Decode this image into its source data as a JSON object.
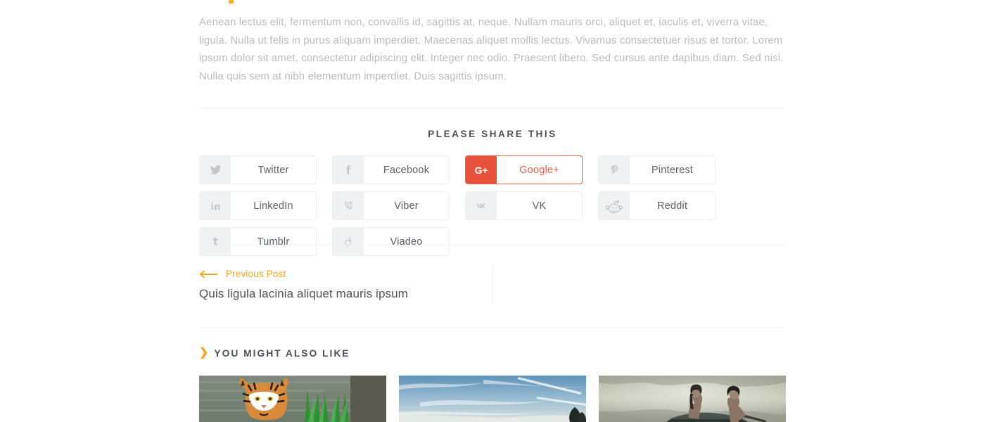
{
  "post": {
    "body": "Aenean lectus elit, fermentum non, convallis id, sagittis at, neque. Nullam mauris orci, aliquet et, iaculis et, viverra vitae, ligula. Nulla ut felis in purus aliquam imperdiet. Maecenas aliquet mollis lectus. Vivamus consectetuer risus et tortor. Lorem ipsum dolor sit amet, consectetur adipiscing elit. Integer nec odio. Praesent libero. Sed cursus ante dapibus diam. Sed nisi. Nulla quis sem at nibh elementum imperdiet. Duis sagittis ipsum."
  },
  "share": {
    "title": "PLEASE SHARE THIS",
    "active_network": "Google+",
    "accent_color": "#e8513c",
    "buttons": [
      {
        "label": "Twitter",
        "icon": "twitter-icon",
        "active": false
      },
      {
        "label": "Facebook",
        "icon": "facebook-icon",
        "active": false
      },
      {
        "label": "Google+",
        "icon": "googleplus-icon",
        "active": true
      },
      {
        "label": "Pinterest",
        "icon": "pinterest-icon",
        "active": false
      },
      {
        "label": "LinkedIn",
        "icon": "linkedin-icon",
        "active": false
      },
      {
        "label": "Viber",
        "icon": "viber-icon",
        "active": false
      },
      {
        "label": "VK",
        "icon": "vk-icon",
        "active": false
      },
      {
        "label": "Reddit",
        "icon": "reddit-icon",
        "active": false
      },
      {
        "label": "Tumblr",
        "icon": "tumblr-icon",
        "active": false
      },
      {
        "label": "Viadeo",
        "icon": "viadeo-icon",
        "active": false
      }
    ]
  },
  "post_nav": {
    "previous": {
      "kicker": "Previous Post",
      "title": "Quis ligula lacinia aliquet mauris ipsum",
      "arrow_icon": "arrow-left-icon",
      "accent_color": "#f5a623"
    }
  },
  "related": {
    "chevron_icon": "chevron-right-icon",
    "title": "YOU MIGHT ALSO LIKE",
    "items": [
      {
        "image_alt": "tiger in water beside green grass"
      },
      {
        "image_alt": "blue sky with wispy clouds and treetop"
      },
      {
        "image_alt": "two people on a boat in misty water"
      }
    ]
  }
}
